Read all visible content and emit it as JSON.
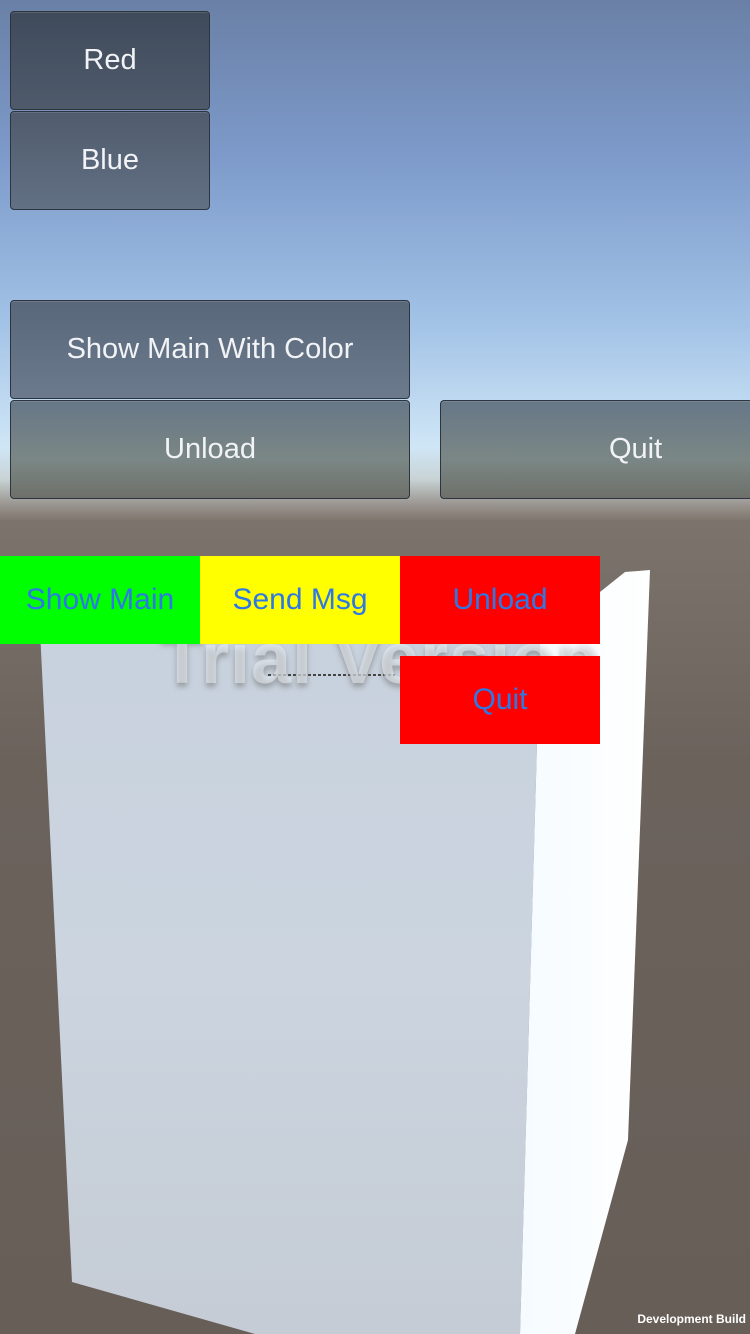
{
  "gui_buttons": {
    "red_label": "Red",
    "blue_label": "Blue",
    "show_main_with_color_label": "Show Main With Color",
    "unload_label": "Unload",
    "quit_label": "Quit"
  },
  "ui_buttons": {
    "show_main": {
      "label": "Show Main",
      "color": "#00ff00"
    },
    "send_msg": {
      "label": "Send Msg",
      "color": "#ffff00"
    },
    "unload": {
      "label": "Unload",
      "color": "#ff0000"
    },
    "quit": {
      "label": "Quit",
      "color": "#ff0000"
    },
    "text_color": "#2e78e6"
  },
  "scene": {
    "watermark": "Trial Version",
    "build_label": "Development Build"
  }
}
